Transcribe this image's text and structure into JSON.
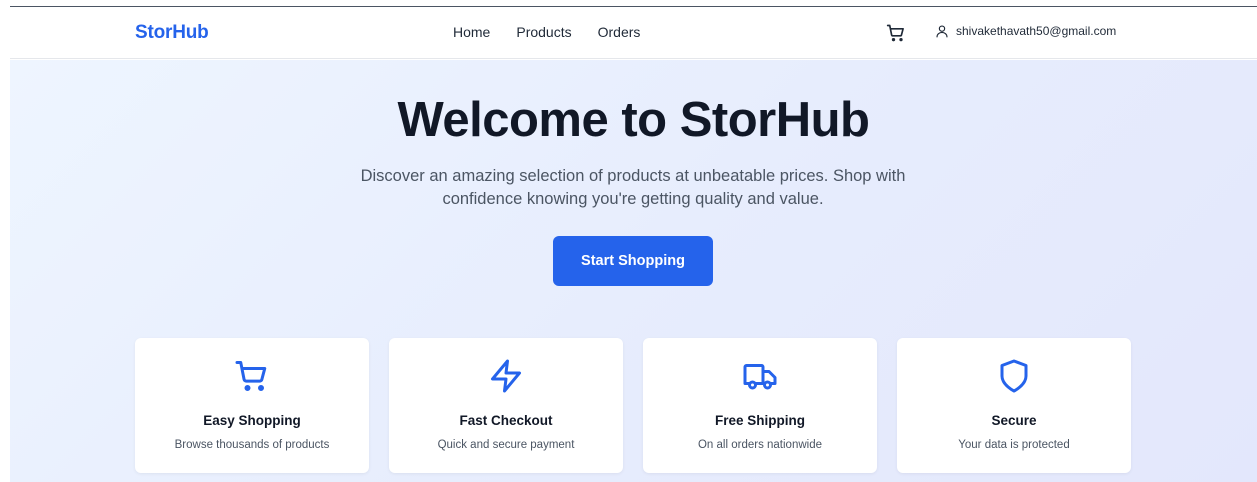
{
  "navbar": {
    "brand": "StorHub",
    "links": [
      "Home",
      "Products",
      "Orders"
    ],
    "user_email": "shivakethavath50@gmail.com"
  },
  "hero": {
    "title": "Welcome to StorHub",
    "subtitle": "Discover an amazing selection of products at unbeatable prices. Shop with confidence knowing you're getting quality and value.",
    "cta_label": "Start Shopping"
  },
  "features": [
    {
      "icon": "shopping-cart-icon",
      "title": "Easy Shopping",
      "description": "Browse thousands of products"
    },
    {
      "icon": "lightning-bolt-icon",
      "title": "Fast Checkout",
      "description": "Quick and secure payment"
    },
    {
      "icon": "truck-icon",
      "title": "Free Shipping",
      "description": "On all orders nationwide"
    },
    {
      "icon": "shield-icon",
      "title": "Secure",
      "description": "Your data is protected"
    }
  ],
  "colors": {
    "accent": "#2563eb",
    "text": "#111827",
    "muted": "#4b5563",
    "hero_background": "#e9effd"
  }
}
